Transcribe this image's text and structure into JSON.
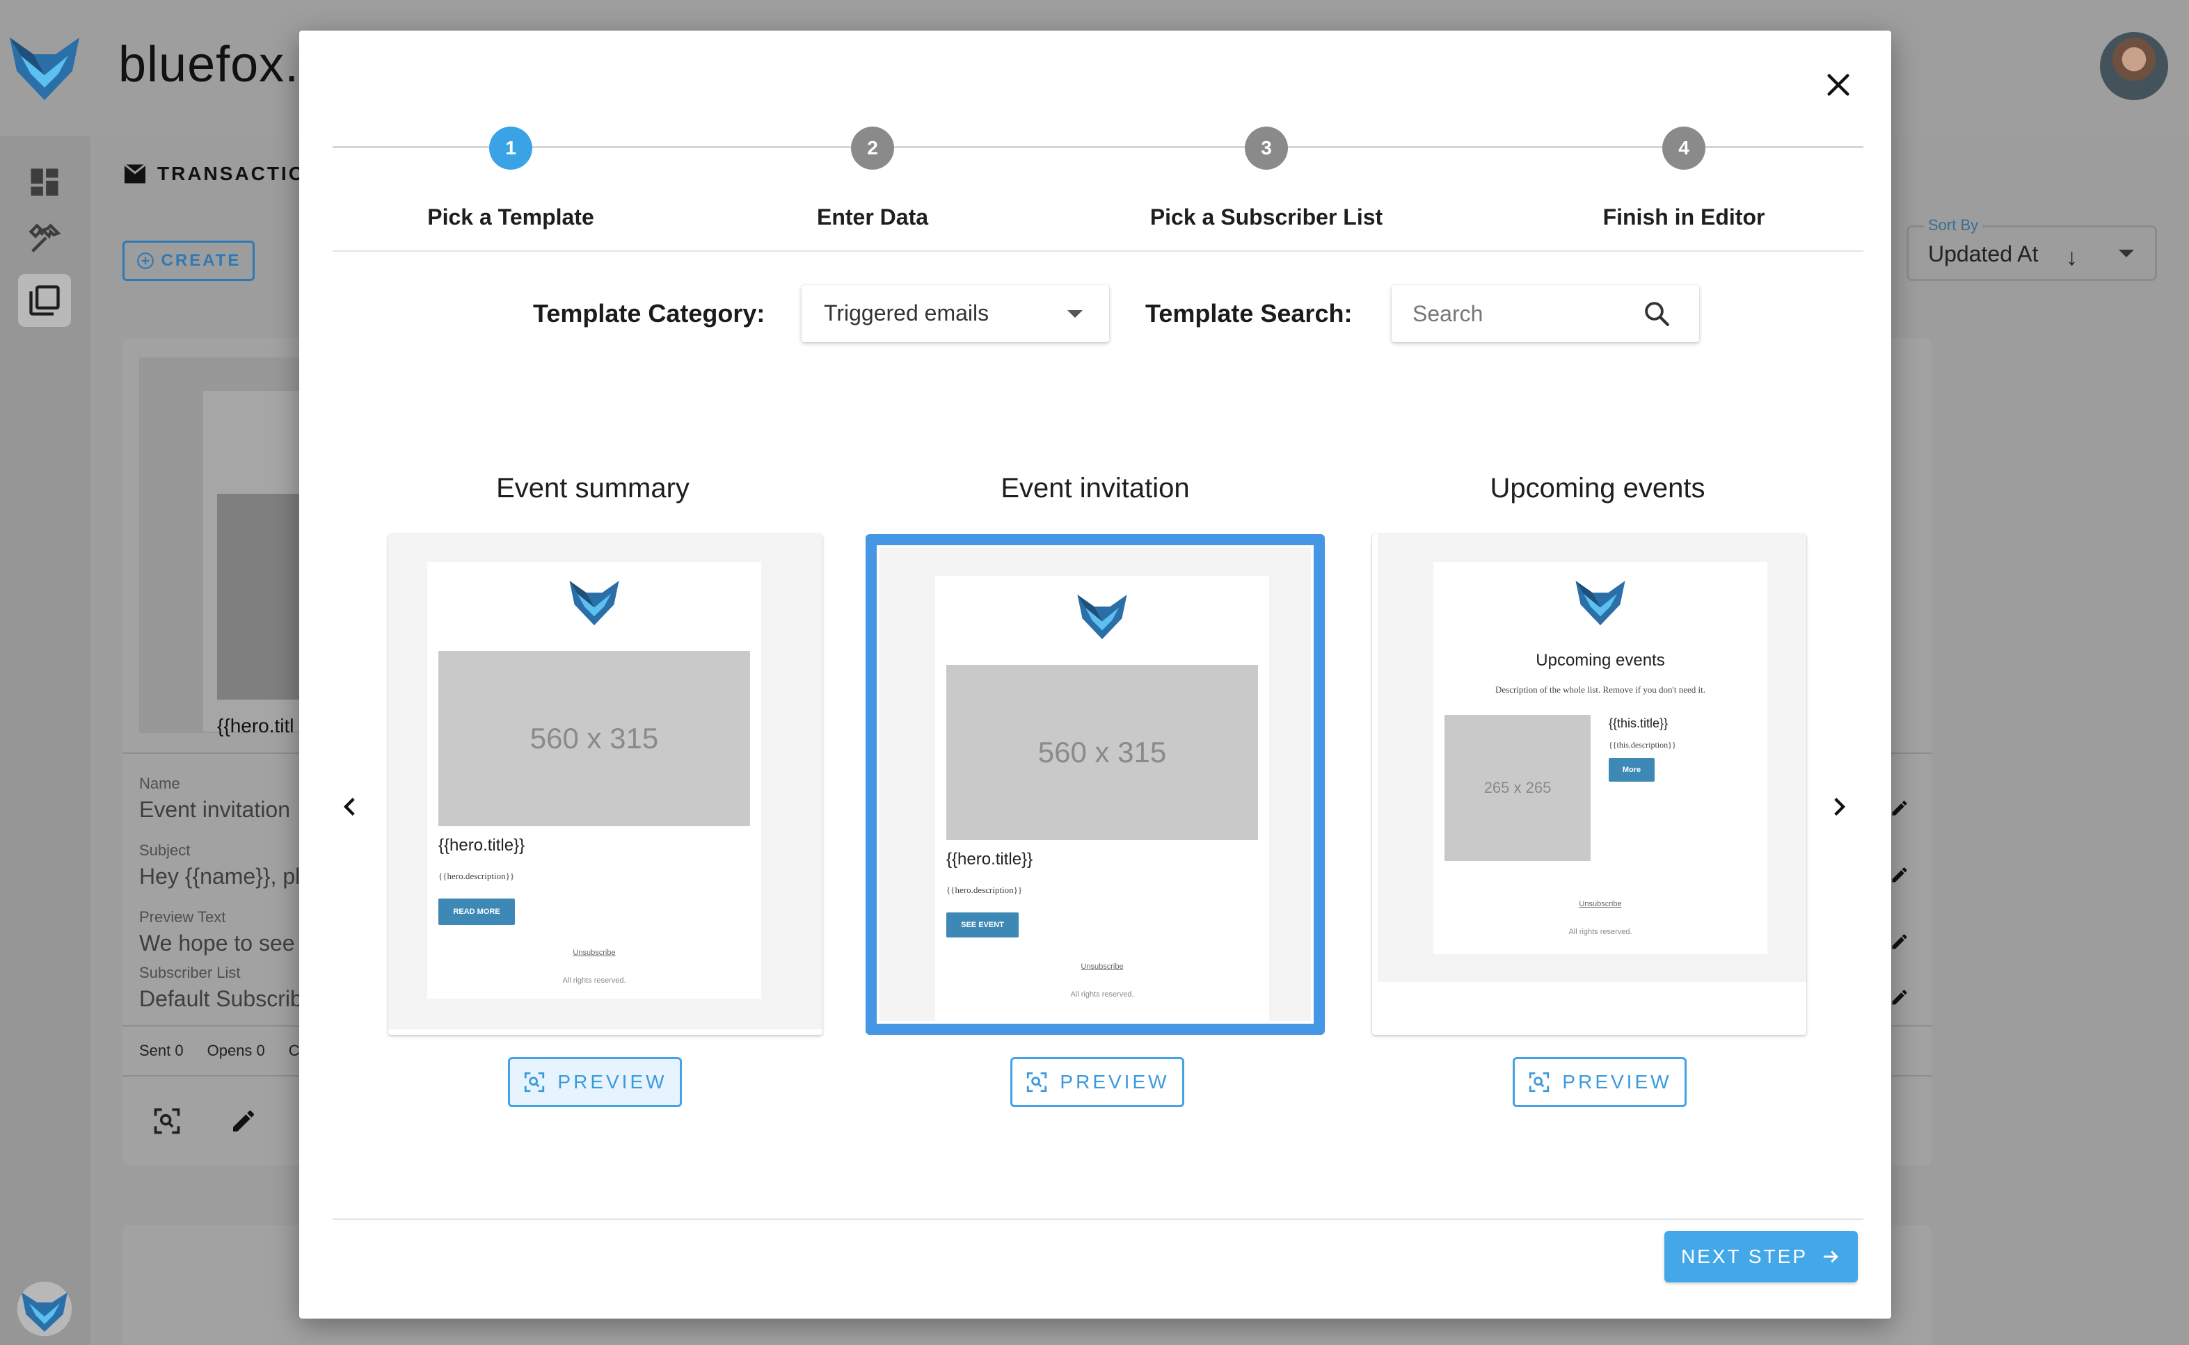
{
  "app": {
    "title": "bluefox.e",
    "section_title": "TRANSACTIO",
    "create_label": "CREATE",
    "sort_label": "Sort By",
    "sort_value": "Updated At"
  },
  "background_card": {
    "hero": "{{hero.titl",
    "name_label": "Name",
    "name_value": "Event invitation",
    "subject_label": "Subject",
    "subject_value": "Hey {{name}}, pl",
    "preview_label": "Preview Text",
    "preview_value": "We hope to see",
    "list_label": "Subscriber List",
    "list_value": "Default Subscrib",
    "sent": "Sent 0",
    "opens": "Opens 0",
    "clicks": "C"
  },
  "modal": {
    "steps": [
      {
        "number": "1",
        "label": "Pick a Template",
        "active": true
      },
      {
        "number": "2",
        "label": "Enter Data",
        "active": false
      },
      {
        "number": "3",
        "label": "Pick a Subscriber List",
        "active": false
      },
      {
        "number": "4",
        "label": "Finish in Editor",
        "active": false
      }
    ],
    "category_label": "Template Category:",
    "category_value": "Triggered emails",
    "search_label": "Template Search:",
    "search_placeholder": "Search",
    "templates": [
      {
        "title": "Event summary",
        "image_text": "560 x 315",
        "hero_title": "{{hero.title}}",
        "hero_desc": "{{hero.description}}",
        "button": "READ MORE",
        "unsubscribe": "Unsubscribe",
        "rights": "All rights reserved.",
        "preview_label": "PREVIEW"
      },
      {
        "title": "Event invitation",
        "image_text": "560 x 315",
        "hero_title": "{{hero.title}}",
        "hero_desc": "{{hero.description}}",
        "button": "SEE EVENT",
        "unsubscribe": "Unsubscribe",
        "rights": "All rights reserved.",
        "preview_label": "PREVIEW",
        "selected": true
      },
      {
        "title": "Upcoming events",
        "heading": "Upcoming events",
        "description": "Description of the whole list. Remove if you don't need it.",
        "image_text": "265 x 265",
        "item_title": "{{this.title}}",
        "item_desc": "{{this.description}}",
        "button": "More",
        "unsubscribe": "Unsubscribe",
        "rights": "All rights reserved.",
        "preview_label": "PREVIEW"
      }
    ],
    "next_label": "NEXT STEP"
  },
  "colors": {
    "accent": "#43a7e8",
    "selected_border": "#4596e4",
    "step_inactive": "#8a8a8a",
    "email_button": "#3e88b6"
  },
  "icons": [
    "fox-logo-icon",
    "close-icon",
    "search-icon",
    "chevron-left-icon",
    "chevron-right-icon",
    "preview-scan-icon",
    "arrow-right-icon",
    "dashboard-icon",
    "tools-icon",
    "templates-icon",
    "pencil-icon",
    "arrow-down-icon"
  ]
}
